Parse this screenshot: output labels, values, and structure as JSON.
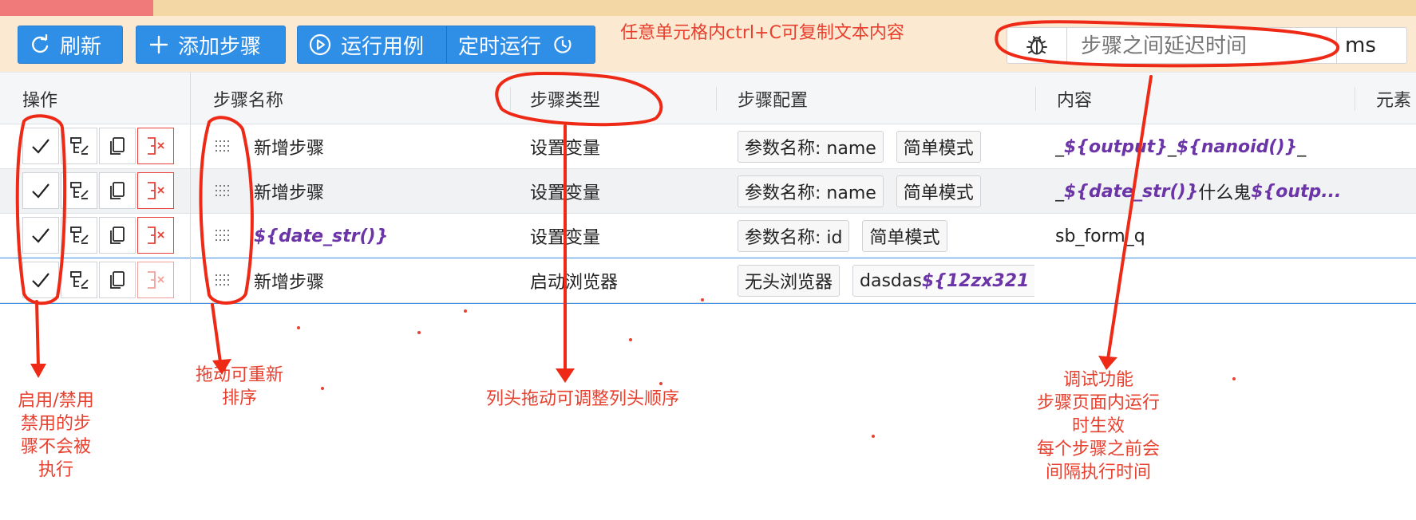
{
  "toolbar": {
    "refresh_label": "刷新",
    "add_step_label": "添加步骤",
    "run_case_label": "运行用例",
    "scheduled_run_label": "定时运行",
    "tip": "任意单元格内ctrl+C可复制文本内容",
    "delay_placeholder": "步骤之间延迟时间",
    "delay_unit": "ms"
  },
  "columns": [
    "操作",
    "步骤名称",
    "步骤类型",
    "步骤配置",
    "内容",
    "元素"
  ],
  "rows": [
    {
      "name": "新增步骤",
      "type": "设置变量",
      "config_tags": [
        "参数名称: name",
        "简单模式"
      ],
      "content_parts": [
        {
          "text": "_",
          "var": false
        },
        {
          "text": "${output}",
          "var": true
        },
        {
          "text": "_",
          "var": false
        },
        {
          "text": "${nanoid()}",
          "var": true
        },
        {
          "text": "_",
          "var": false
        }
      ]
    },
    {
      "name": "新增步骤",
      "type": "设置变量",
      "config_tags": [
        "参数名称: name",
        "简单模式"
      ],
      "content_parts": [
        {
          "text": "_",
          "var": false
        },
        {
          "text": "${date_str()}",
          "var": true
        },
        {
          "text": "什么鬼",
          "var": false
        },
        {
          "text": "${outp...",
          "var": true
        }
      ]
    },
    {
      "name": "${date_str()}",
      "name_is_var": true,
      "type": "设置变量",
      "config_tags": [
        "参数名称: id",
        "简单模式"
      ],
      "content_parts": [
        {
          "text": "sb_form_q",
          "var": false
        }
      ]
    },
    {
      "name": "新增步骤",
      "type": "启动浏览器",
      "config_tags": [
        "无头浏览器"
      ],
      "config_extra_plain": "dasdas",
      "config_extra_var": "${12zx321",
      "content_parts": []
    }
  ],
  "annotations": {
    "enable": "启用/禁用\n禁用的步\n骤不会被\n执行",
    "drag": "拖动可重新\n排序",
    "column_drag": "列头拖动可调整列头顺序",
    "debug": "调试功能\n步骤页面内运行\n时生效\n每个步骤之前会\n间隔执行时间"
  },
  "colors": {
    "primary": "#2f8ee6",
    "annotation": "#e8402f",
    "variable": "#6b35a7",
    "toolbar_bg": "#fbe9d2"
  }
}
